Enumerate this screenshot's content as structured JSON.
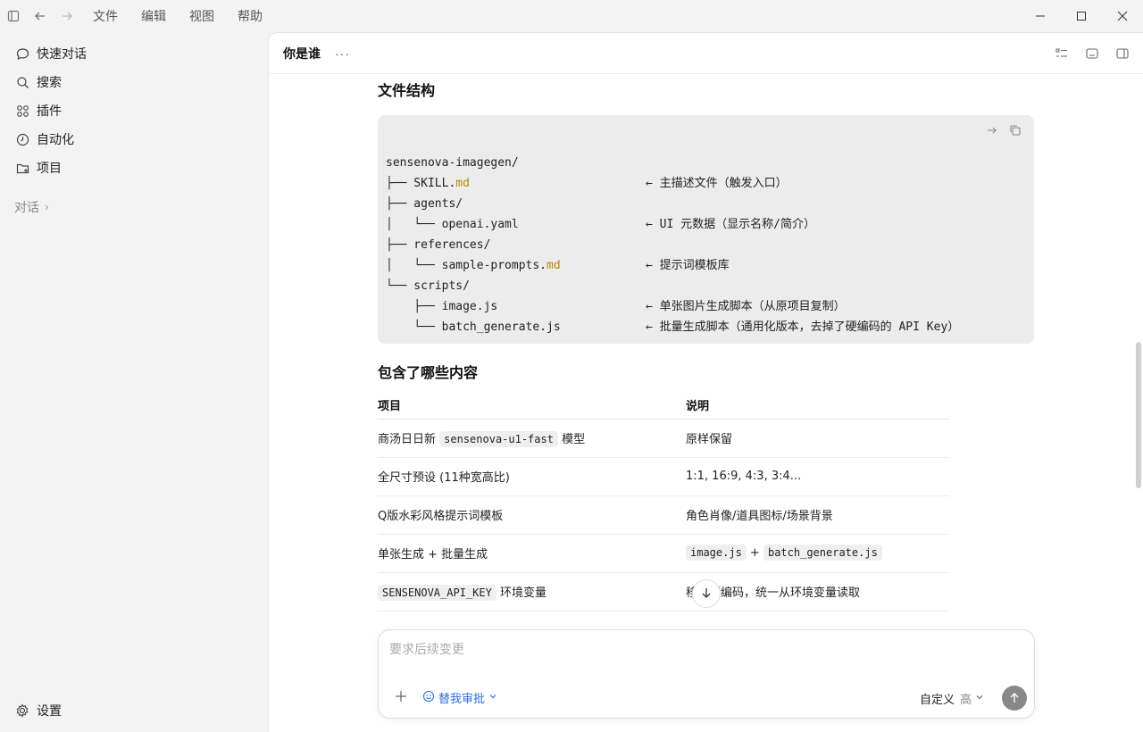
{
  "titlebar": {
    "menu": [
      "文件",
      "编辑",
      "视图",
      "帮助"
    ]
  },
  "sidebar": {
    "items": [
      {
        "label": "快速对话",
        "icon": "chat-bubble-icon"
      },
      {
        "label": "搜索",
        "icon": "search-icon"
      },
      {
        "label": "插件",
        "icon": "plugins-grid-icon"
      },
      {
        "label": "自动化",
        "icon": "clock-icon"
      },
      {
        "label": "项目",
        "icon": "folder-icon"
      }
    ],
    "section_label": "对话",
    "settings_label": "设置"
  },
  "main": {
    "title": "你是谁",
    "more": "···"
  },
  "content": {
    "heading1": "文件结构",
    "code_lines": [
      {
        "tree": "sensenova-imagegen/",
        "md": "",
        "note": ""
      },
      {
        "tree": "├── SKILL.",
        "md": "md",
        "note": "← 主描述文件（触发入口）"
      },
      {
        "tree": "├── agents/",
        "md": "",
        "note": ""
      },
      {
        "tree": "│   └── openai.yaml",
        "md": "",
        "note": "← UI 元数据（显示名称/简介）"
      },
      {
        "tree": "├── references/",
        "md": "",
        "note": ""
      },
      {
        "tree": "│   └── sample-prompts.",
        "md": "md",
        "note": "← 提示词模板库"
      },
      {
        "tree": "└── scripts/",
        "md": "",
        "note": ""
      },
      {
        "tree": "    ├── image.js",
        "md": "",
        "note": "← 单张图片生成脚本（从原项目复制）"
      },
      {
        "tree": "    └── batch_generate.js",
        "md": "",
        "note": "← 批量生成脚本（通用化版本，去掉了硬编码的 API Key）"
      }
    ],
    "heading2": "包含了哪些内容",
    "table": {
      "headers": [
        "项目",
        "说明"
      ],
      "rows": [
        {
          "a_pre": "商汤日日新 ",
          "a_code": "sensenova-u1-fast",
          "a_post": " 模型",
          "b": "原样保留"
        },
        {
          "a_pre": "全尺寸预设 (11种宽高比)",
          "a_code": "",
          "a_post": "",
          "b": "1:1, 16:9, 4:3, 3:4..."
        },
        {
          "a_pre": "Q版水彩风格提示词模板",
          "a_code": "",
          "a_post": "",
          "b": "角色肖像/道具图标/场景背景"
        },
        {
          "a_pre": "单张生成 + 批量生成",
          "a_code": "",
          "a_post": "",
          "b_code1": "image.js",
          "b_mid": " + ",
          "b_code2": "batch_generate.js"
        },
        {
          "a_pre": "",
          "a_code": "SENSENOVA_API_KEY",
          "a_post": " 环境变量",
          "b": "移除硬编码，统一从环境变量读取"
        }
      ]
    }
  },
  "composer": {
    "placeholder": "要求后续变更",
    "approve_label": "替我审批",
    "mode_label": "自定义",
    "level_label": "高"
  }
}
